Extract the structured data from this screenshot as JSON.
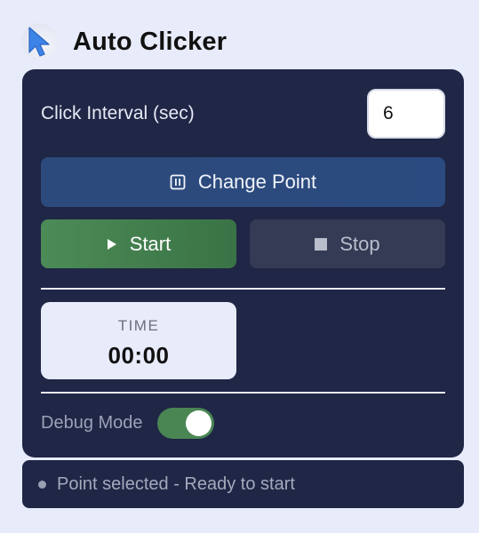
{
  "app": {
    "title": "Auto Clicker",
    "logo_icon": "cursor-arrow-icon"
  },
  "interval": {
    "label": "Click Interval (sec)",
    "value": "6"
  },
  "buttons": {
    "change_point": {
      "label": "Change Point",
      "icon": "crosshair-square-icon"
    },
    "start": {
      "label": "Start",
      "icon": "play-icon"
    },
    "stop": {
      "label": "Stop",
      "icon": "stop-icon"
    }
  },
  "timer": {
    "label": "TIME",
    "value": "00:00"
  },
  "debug": {
    "label": "Debug Mode",
    "enabled": true
  },
  "status": {
    "text": "Point selected - Ready to start"
  },
  "colors": {
    "background": "#e8ebfa",
    "panel": "#1f2646",
    "change_point": "#2c4a7b",
    "start": "#4c8b57",
    "stop": "#353b54",
    "toggle_on": "#4a8554"
  }
}
